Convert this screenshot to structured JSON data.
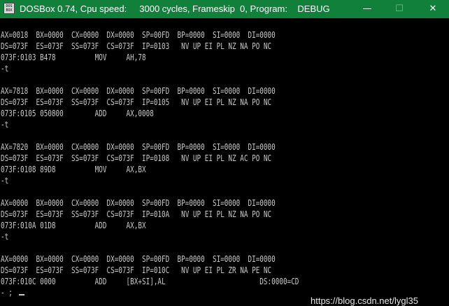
{
  "window": {
    "icon_text": "DOS\nBOX",
    "title": "DOSBox 0.74, Cpu speed:     3000 cycles, Frameskip  0, Program:    DEBUG",
    "minimize_glyph": "—",
    "maximize_glyph": "☐",
    "close_glyph": "✕",
    "titlebar_color": "#10803a"
  },
  "console": {
    "lines": [
      "",
      "AX=0018  BX=0000  CX=0000  DX=0000  SP=00FD  BP=0000  SI=0000  DI=0000",
      "DS=073F  ES=073F  SS=073F  CS=073F  IP=0103   NV UP EI PL NZ NA PO NC",
      "073F:0103 B478          MOV     AH,78",
      "-t",
      "",
      "AX=7818  BX=0000  CX=0000  DX=0000  SP=00FD  BP=0000  SI=0000  DI=0000",
      "DS=073F  ES=073F  SS=073F  CS=073F  IP=0105   NV UP EI PL NZ NA PO NC",
      "073F:0105 050800        ADD     AX,0008",
      "-t",
      "",
      "AX=7820  BX=0000  CX=0000  DX=0000  SP=00FD  BP=0000  SI=0000  DI=0000",
      "DS=073F  ES=073F  SS=073F  CS=073F  IP=0108   NV UP EI PL NZ AC PO NC",
      "073F:0108 89D8          MOV     AX,BX",
      "-t",
      "",
      "AX=0000  BX=0000  CX=0000  DX=0000  SP=00FD  BP=0000  SI=0000  DI=0000",
      "DS=073F  ES=073F  SS=073F  CS=073F  IP=010A   NV UP EI PL NZ NA PO NC",
      "073F:010A 01D8          ADD     AX,BX",
      "-t",
      "",
      "AX=0000  BX=0000  CX=0000  DX=0000  SP=00FD  BP=0000  SI=0000  DI=0000",
      "DS=073F  ES=073F  SS=073F  CS=073F  IP=010C   NV UP EI PL ZR NA PE NC",
      "073F:010C 0000          ADD     [BX+SI],AL                        DS:0000=CD",
      "- ;"
    ],
    "text_color": "#c8c8c8"
  },
  "watermark": "https://blog.csdn.net/lygl35"
}
